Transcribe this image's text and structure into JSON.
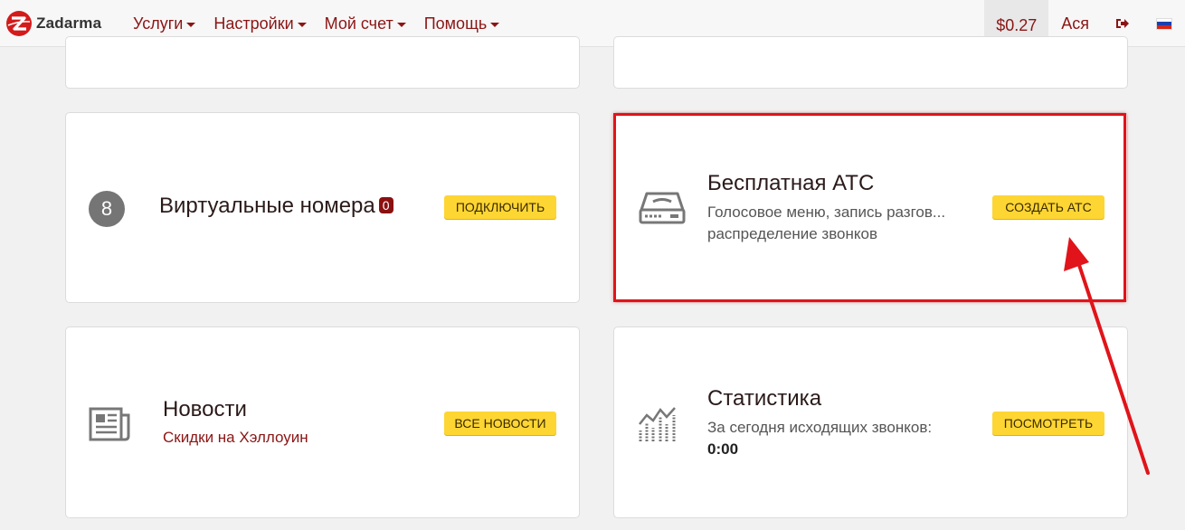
{
  "nav": {
    "logo_text": "Zadarma",
    "menu": [
      {
        "label": "Услуги"
      },
      {
        "label": "Настройки"
      },
      {
        "label": "Мой счет"
      },
      {
        "label": "Помощь"
      }
    ],
    "balance": "$0.27",
    "user": "Ася",
    "language": "RU"
  },
  "cards": {
    "numbers": {
      "count": "8",
      "title": "Виртуальные номера",
      "badge": "0",
      "button": "ПОДКЛЮЧИТЬ"
    },
    "pbx": {
      "title": "Бесплатная АТС",
      "desc_line1": "Голосовое меню, запись разгов...",
      "desc_line2": "распределение звонков",
      "button": "СОЗДАТЬ АТС"
    },
    "news": {
      "title": "Новости",
      "link": "Скидки на Хэллоуин",
      "button": "ВСЕ НОВОСТИ"
    },
    "stats": {
      "title": "Статистика",
      "desc": "За сегодня исходящих звонков:",
      "value": "0:00",
      "button": "ПОСМОТРЕТЬ"
    }
  },
  "colors": {
    "brand": "#8b1515",
    "button": "#fed633",
    "annotation": "#e0141a"
  }
}
